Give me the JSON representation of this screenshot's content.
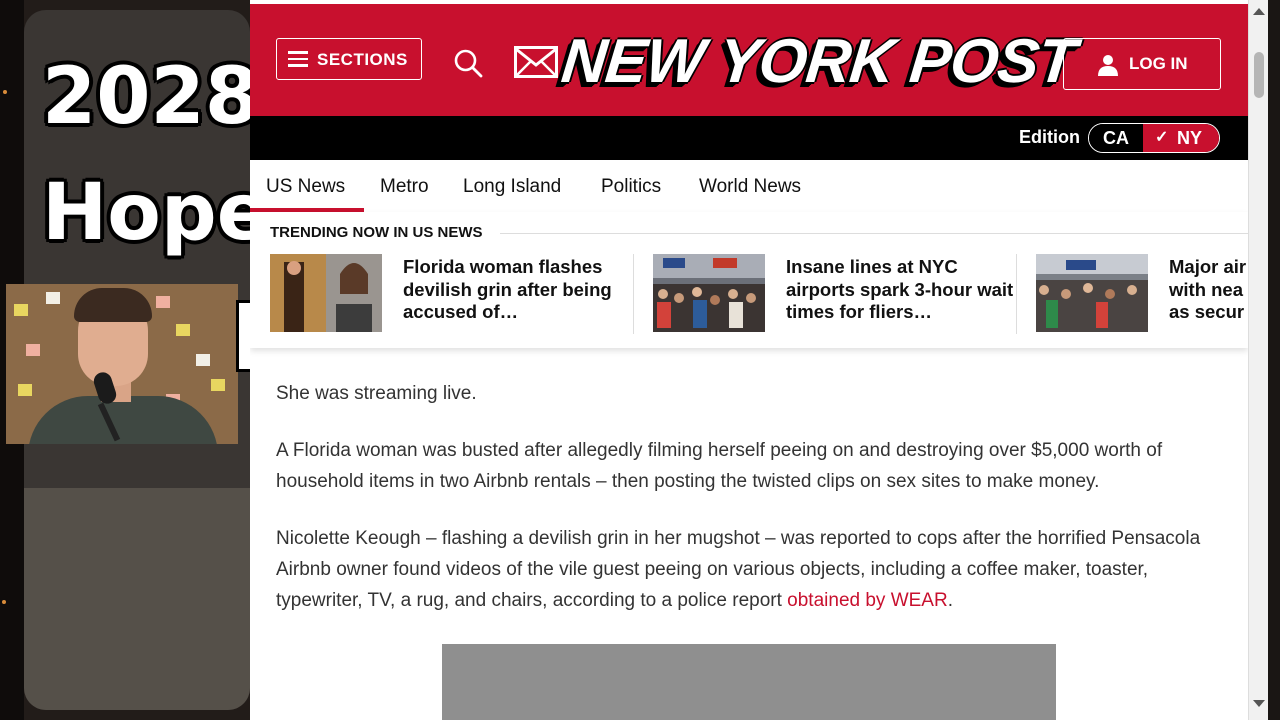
{
  "overlay": {
    "title_line1": "2028",
    "title_line2": "Hope"
  },
  "header": {
    "sections_label": "SECTIONS",
    "logo_text": "NEW YORK POST",
    "login_label": "LOG IN",
    "brand_color": "#c8102e"
  },
  "edition": {
    "label": "Edition",
    "options": [
      "CA",
      "NY"
    ],
    "selected": "NY"
  },
  "nav": {
    "tabs": [
      "US News",
      "Metro",
      "Long Island",
      "Politics",
      "World News"
    ],
    "active": "US News"
  },
  "trending": {
    "title": "TRENDING NOW IN US NEWS",
    "items": [
      {
        "headline": "Florida woman flashes devilish grin after being accused of…"
      },
      {
        "headline": "Insane lines at NYC airports spark 3-hour wait times for fliers…"
      },
      {
        "headline": "Major air with nea as secur"
      }
    ]
  },
  "article": {
    "p1": "She was streaming live.",
    "p2": "A Florida woman was busted after allegedly filming herself peeing on and destroying over $5,000 worth of household items in two Airbnb rentals – then posting the twisted clips on sex sites to make money.",
    "p3_text": "Nicolette Keough – flashing a devilish grin in her mugshot – was reported to cops after the horrified Pensacola Airbnb owner found videos of the vile guest peeing on various objects, including a coffee maker, toaster, typewriter, TV, a rug, and chairs, according to a police report ",
    "p3_link": "obtained by WEAR",
    "p3_end": "."
  }
}
